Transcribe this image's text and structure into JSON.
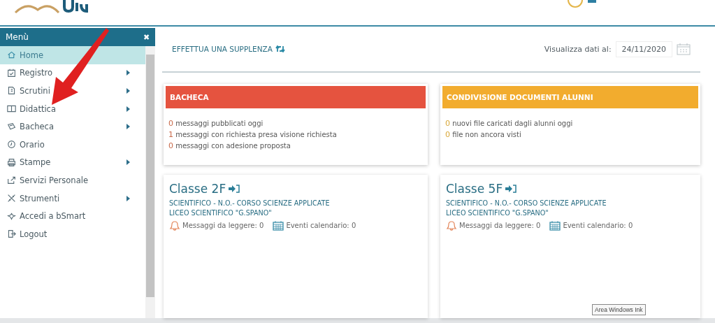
{
  "menu": {
    "title": "Menù",
    "close": "✖",
    "items": [
      {
        "label": "Home",
        "selected": true,
        "submenu": false
      },
      {
        "label": "Registro",
        "selected": false,
        "submenu": true
      },
      {
        "label": "Scrutini",
        "selected": false,
        "submenu": true
      },
      {
        "label": "Didattica",
        "selected": false,
        "submenu": true
      },
      {
        "label": "Bacheca",
        "selected": false,
        "submenu": true
      },
      {
        "label": "Orario",
        "selected": false,
        "submenu": false
      },
      {
        "label": "Stampe",
        "selected": false,
        "submenu": true
      },
      {
        "label": "Servizi Personale",
        "selected": false,
        "submenu": false
      },
      {
        "label": "Strumenti",
        "selected": false,
        "submenu": true
      },
      {
        "label": "Accedi a bSmart",
        "selected": false,
        "submenu": false
      },
      {
        "label": "Logout",
        "selected": false,
        "submenu": false
      }
    ]
  },
  "toolbar": {
    "substitution": "EFFETTUA UNA SUPPLENZA",
    "date_label": "Visualizza dati al:",
    "date": "24/11/2020"
  },
  "panels": [
    {
      "title": "BACHECA",
      "color": "#e5533f",
      "lines": [
        {
          "count": "0",
          "text": "messaggi pubblicati oggi"
        },
        {
          "count": "1",
          "text": "messaggi con richiesta presa visione richiesta"
        },
        {
          "count": "0",
          "text": "messaggi con adesione proposta"
        }
      ]
    },
    {
      "title": "CONDIVISIONE DOCUMENTI ALUNNI",
      "color": "#f2ac2e",
      "lines": [
        {
          "count": "0",
          "text": "nuovi file caricati dagli alunni oggi"
        },
        {
          "count": "0",
          "text": "file non ancora visti"
        }
      ]
    }
  ],
  "classes": [
    {
      "name": "Classe 2F",
      "course": "SCIENTIFICO - N.O.- CORSO SCIENZE APPLICATE",
      "school": "LICEO SCIENTIFICO \"G.SPANO\"",
      "messages": "Messaggi da leggere: 0",
      "events": "Eventi calendario: 0"
    },
    {
      "name": "Classe 5F",
      "course": "SCIENTIFICO - N.O.- CORSO SCIENZE APPLICATE",
      "school": "LICEO SCIENTIFICO \"G.SPANO\"",
      "messages": "Messaggi da leggere: 0",
      "events": "Eventi calendario: 0"
    }
  ],
  "tooltip": "Area Windows Ink"
}
